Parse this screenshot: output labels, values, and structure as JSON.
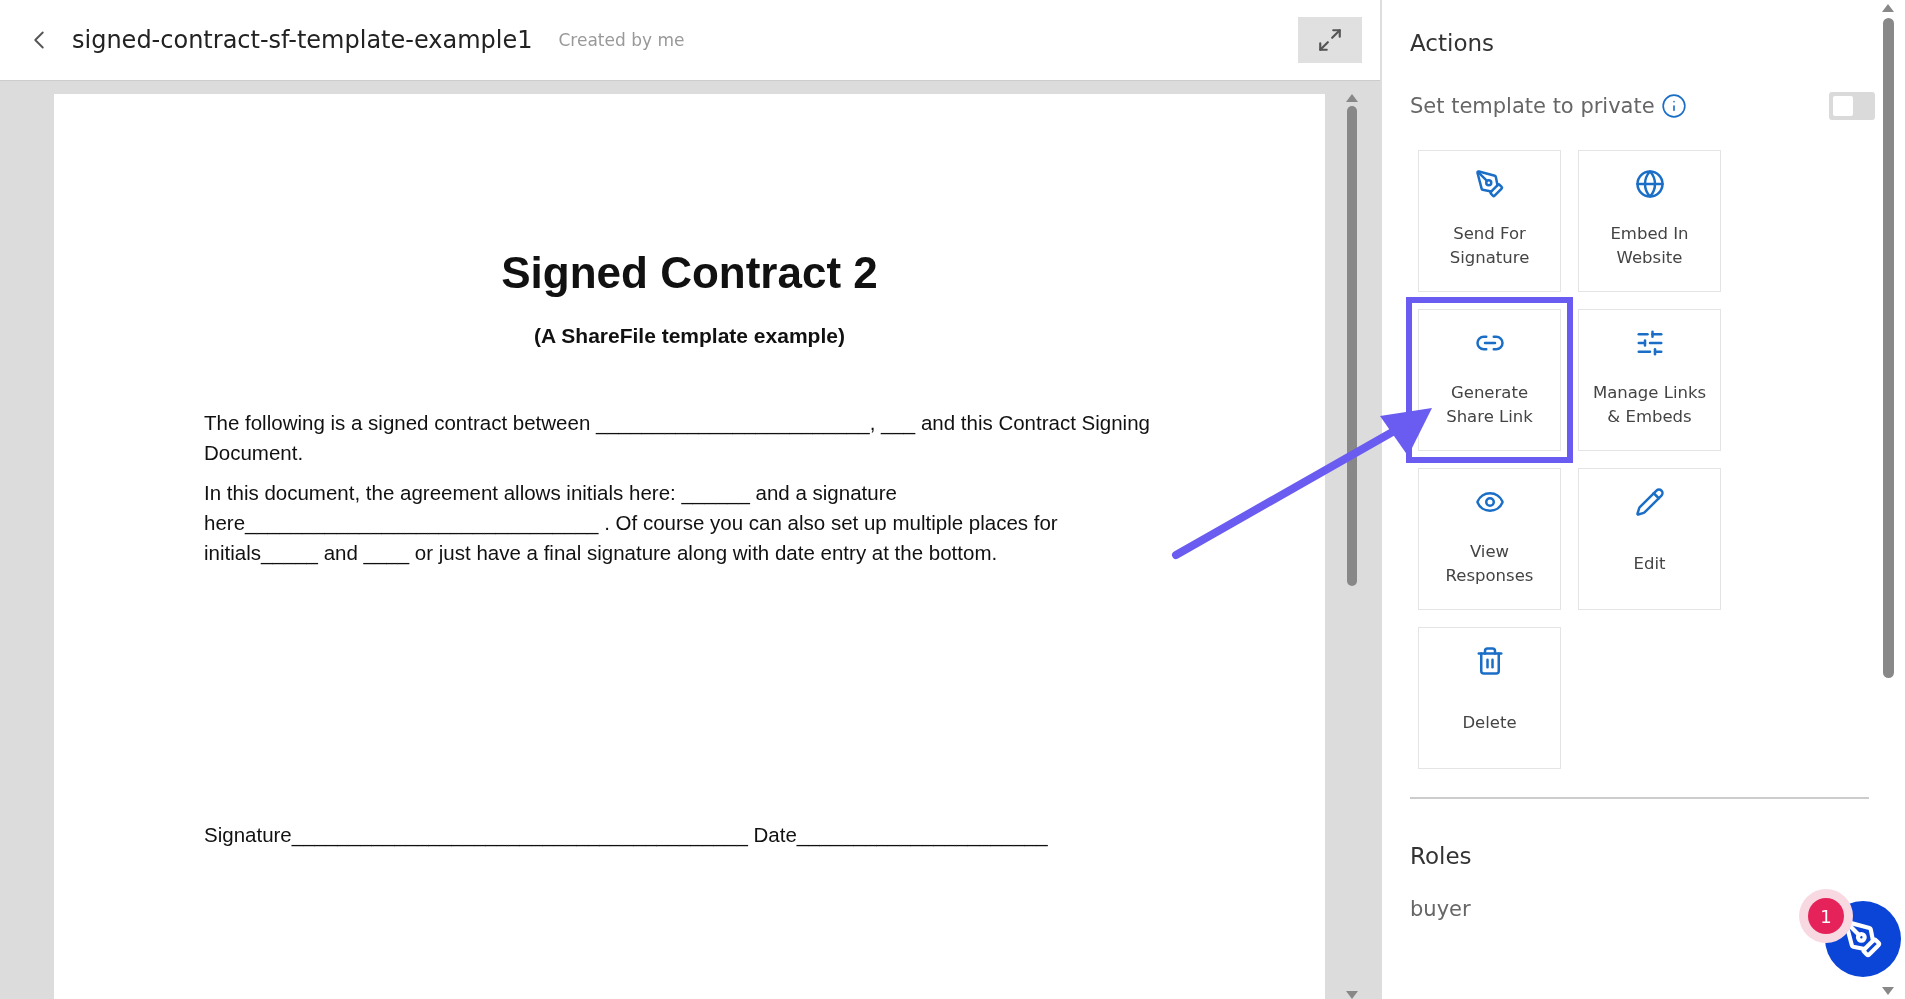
{
  "header": {
    "title": "signed-contract-sf-template-example1",
    "subtitle": "Created by me"
  },
  "document": {
    "title": "Signed Contract 2",
    "subtitle": "(A ShareFile template example)",
    "paragraphs": [
      "The following is a signed contract between ________________________, ___ and this Contract Signing Document.",
      "In this document, the agreement allows initials here: ______ and a signature here_______________________________ . Of course you can also set up multiple places for initials_____ and ____ or just have a final signature along with date entry at the bottom."
    ],
    "signature_line": "Signature________________________________________ Date______________________"
  },
  "actions": {
    "heading": "Actions",
    "private_toggle": {
      "label": "Set template to private",
      "on": false
    },
    "tiles": [
      {
        "label": "Send For Signature",
        "highlighted": false
      },
      {
        "label": "Embed In Website",
        "highlighted": false
      },
      {
        "label": "Generate Share Link",
        "highlighted": true
      },
      {
        "label": "Manage Links & Embeds",
        "highlighted": false
      },
      {
        "label": "View Responses",
        "highlighted": false
      },
      {
        "label": "Edit",
        "highlighted": false
      },
      {
        "label": "Delete",
        "highlighted": false
      }
    ]
  },
  "roles": {
    "heading": "Roles",
    "items": [
      "buyer"
    ]
  },
  "fab": {
    "badge": "1"
  }
}
